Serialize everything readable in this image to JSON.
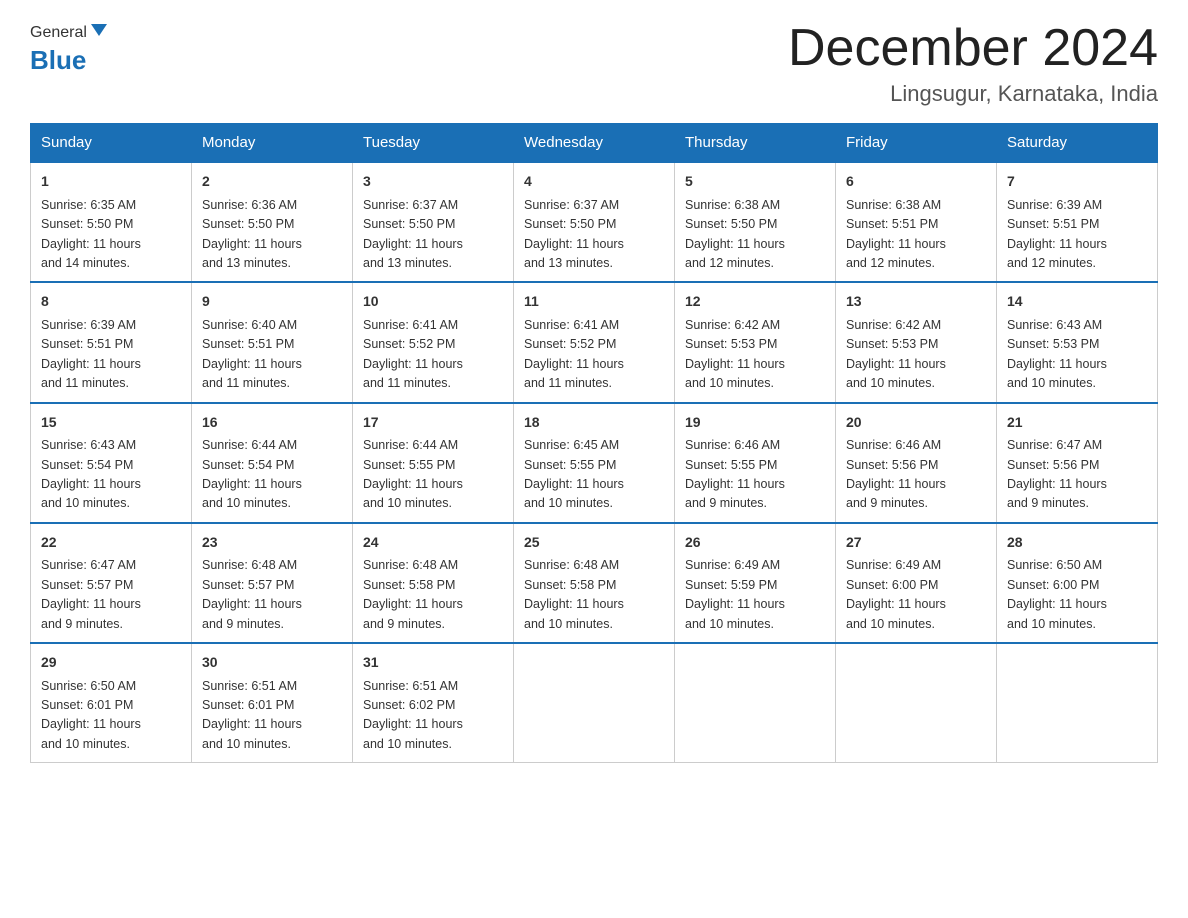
{
  "header": {
    "logo_general": "General",
    "logo_blue": "Blue",
    "month_title": "December 2024",
    "location": "Lingsugur, Karnataka, India"
  },
  "calendar": {
    "days": [
      "Sunday",
      "Monday",
      "Tuesday",
      "Wednesday",
      "Thursday",
      "Friday",
      "Saturday"
    ],
    "rows": [
      [
        {
          "day": "1",
          "sunrise": "6:35 AM",
          "sunset": "5:50 PM",
          "daylight": "11 hours and 14 minutes."
        },
        {
          "day": "2",
          "sunrise": "6:36 AM",
          "sunset": "5:50 PM",
          "daylight": "11 hours and 13 minutes."
        },
        {
          "day": "3",
          "sunrise": "6:37 AM",
          "sunset": "5:50 PM",
          "daylight": "11 hours and 13 minutes."
        },
        {
          "day": "4",
          "sunrise": "6:37 AM",
          "sunset": "5:50 PM",
          "daylight": "11 hours and 13 minutes."
        },
        {
          "day": "5",
          "sunrise": "6:38 AM",
          "sunset": "5:50 PM",
          "daylight": "11 hours and 12 minutes."
        },
        {
          "day": "6",
          "sunrise": "6:38 AM",
          "sunset": "5:51 PM",
          "daylight": "11 hours and 12 minutes."
        },
        {
          "day": "7",
          "sunrise": "6:39 AM",
          "sunset": "5:51 PM",
          "daylight": "11 hours and 12 minutes."
        }
      ],
      [
        {
          "day": "8",
          "sunrise": "6:39 AM",
          "sunset": "5:51 PM",
          "daylight": "11 hours and 11 minutes."
        },
        {
          "day": "9",
          "sunrise": "6:40 AM",
          "sunset": "5:51 PM",
          "daylight": "11 hours and 11 minutes."
        },
        {
          "day": "10",
          "sunrise": "6:41 AM",
          "sunset": "5:52 PM",
          "daylight": "11 hours and 11 minutes."
        },
        {
          "day": "11",
          "sunrise": "6:41 AM",
          "sunset": "5:52 PM",
          "daylight": "11 hours and 11 minutes."
        },
        {
          "day": "12",
          "sunrise": "6:42 AM",
          "sunset": "5:53 PM",
          "daylight": "11 hours and 10 minutes."
        },
        {
          "day": "13",
          "sunrise": "6:42 AM",
          "sunset": "5:53 PM",
          "daylight": "11 hours and 10 minutes."
        },
        {
          "day": "14",
          "sunrise": "6:43 AM",
          "sunset": "5:53 PM",
          "daylight": "11 hours and 10 minutes."
        }
      ],
      [
        {
          "day": "15",
          "sunrise": "6:43 AM",
          "sunset": "5:54 PM",
          "daylight": "11 hours and 10 minutes."
        },
        {
          "day": "16",
          "sunrise": "6:44 AM",
          "sunset": "5:54 PM",
          "daylight": "11 hours and 10 minutes."
        },
        {
          "day": "17",
          "sunrise": "6:44 AM",
          "sunset": "5:55 PM",
          "daylight": "11 hours and 10 minutes."
        },
        {
          "day": "18",
          "sunrise": "6:45 AM",
          "sunset": "5:55 PM",
          "daylight": "11 hours and 10 minutes."
        },
        {
          "day": "19",
          "sunrise": "6:46 AM",
          "sunset": "5:55 PM",
          "daylight": "11 hours and 9 minutes."
        },
        {
          "day": "20",
          "sunrise": "6:46 AM",
          "sunset": "5:56 PM",
          "daylight": "11 hours and 9 minutes."
        },
        {
          "day": "21",
          "sunrise": "6:47 AM",
          "sunset": "5:56 PM",
          "daylight": "11 hours and 9 minutes."
        }
      ],
      [
        {
          "day": "22",
          "sunrise": "6:47 AM",
          "sunset": "5:57 PM",
          "daylight": "11 hours and 9 minutes."
        },
        {
          "day": "23",
          "sunrise": "6:48 AM",
          "sunset": "5:57 PM",
          "daylight": "11 hours and 9 minutes."
        },
        {
          "day": "24",
          "sunrise": "6:48 AM",
          "sunset": "5:58 PM",
          "daylight": "11 hours and 9 minutes."
        },
        {
          "day": "25",
          "sunrise": "6:48 AM",
          "sunset": "5:58 PM",
          "daylight": "11 hours and 10 minutes."
        },
        {
          "day": "26",
          "sunrise": "6:49 AM",
          "sunset": "5:59 PM",
          "daylight": "11 hours and 10 minutes."
        },
        {
          "day": "27",
          "sunrise": "6:49 AM",
          "sunset": "6:00 PM",
          "daylight": "11 hours and 10 minutes."
        },
        {
          "day": "28",
          "sunrise": "6:50 AM",
          "sunset": "6:00 PM",
          "daylight": "11 hours and 10 minutes."
        }
      ],
      [
        {
          "day": "29",
          "sunrise": "6:50 AM",
          "sunset": "6:01 PM",
          "daylight": "11 hours and 10 minutes."
        },
        {
          "day": "30",
          "sunrise": "6:51 AM",
          "sunset": "6:01 PM",
          "daylight": "11 hours and 10 minutes."
        },
        {
          "day": "31",
          "sunrise": "6:51 AM",
          "sunset": "6:02 PM",
          "daylight": "11 hours and 10 minutes."
        },
        null,
        null,
        null,
        null
      ]
    ],
    "sunrise_label": "Sunrise:",
    "sunset_label": "Sunset:",
    "daylight_label": "Daylight:"
  }
}
